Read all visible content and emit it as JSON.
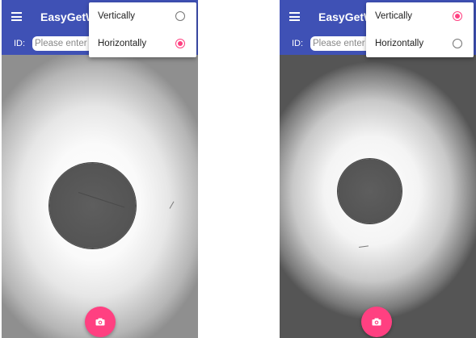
{
  "screens": [
    {
      "app_title": "EasyGetW",
      "id_label": "ID:",
      "id_placeholder": "Please enter",
      "id_value": "",
      "menu": {
        "items": [
          {
            "label": "Vertically",
            "checked": false
          },
          {
            "label": "Horizontally",
            "checked": true
          }
        ]
      },
      "camera_button_icon": "camera-icon"
    },
    {
      "app_title": "EasyGetW",
      "id_label": "ID:",
      "id_placeholder": "Please enter",
      "id_value": "",
      "menu": {
        "items": [
          {
            "label": "Vertically",
            "checked": true
          },
          {
            "label": "Horizontally",
            "checked": false
          }
        ]
      },
      "camera_button_icon": "camera-icon"
    }
  ],
  "colors": {
    "app_bar": "#3f51b5",
    "accent": "#ff4081",
    "radio_unchecked": "#757575"
  }
}
